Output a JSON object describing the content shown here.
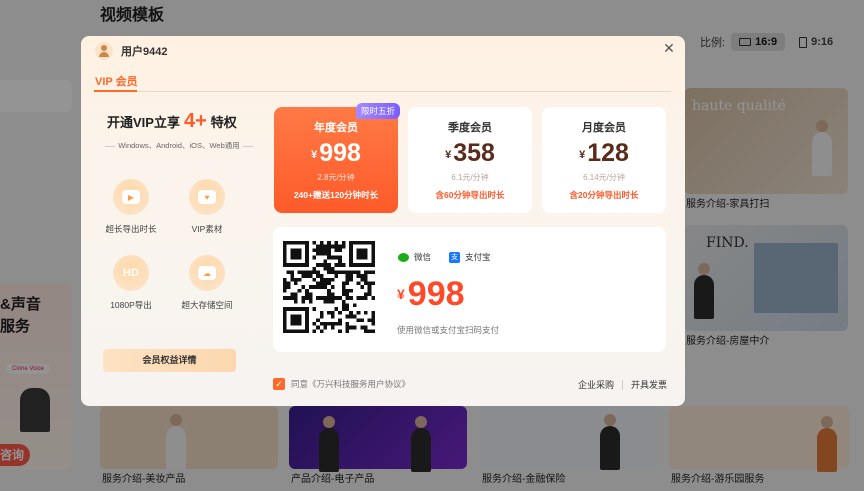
{
  "background": {
    "page_title": "视频模板",
    "ratio_label": "比例:",
    "ratios": [
      "16:9",
      "9:16"
    ],
    "promo": {
      "text_line1": "&声音",
      "text_line2": "服务",
      "tag": "Clone Voice",
      "button": "咨询"
    },
    "templates": [
      {
        "label": "服务介绍-家具打扫"
      },
      {
        "label": "服务介绍-房屋中介"
      },
      {
        "label": "服务介绍-美妆产品"
      },
      {
        "label": "产品介绍-电子产品"
      },
      {
        "label": "服务介绍-金融保险"
      },
      {
        "label": "服务介绍-游乐园服务"
      }
    ],
    "thumb_texts": {
      "haute": "haute qualité",
      "find": "FIND."
    }
  },
  "modal": {
    "user_name": "用户9442",
    "close_icon": "close-icon",
    "tab": "VIP 会员",
    "benefits": {
      "title_prefix": "开通VIP立享",
      "title_big": "4+",
      "title_suffix": "特权",
      "platforms": "Windows、Android、iOS、Web通用",
      "features": [
        {
          "icon": "video-icon",
          "label": "超长导出时长"
        },
        {
          "icon": "material-icon",
          "label": "VIP素材"
        },
        {
          "icon": "hd-icon",
          "label": "1080P导出",
          "glyph": "HD"
        },
        {
          "icon": "cloud-storage-icon",
          "label": "超大存储空间"
        }
      ],
      "details_button": "会员权益详情"
    },
    "plans": [
      {
        "name": "年度会员",
        "currency": "¥",
        "price": "998",
        "rate": "2.8元/分钟",
        "bonus": "240+赠送120分钟时长",
        "badge": "限时五折",
        "selected": true
      },
      {
        "name": "季度会员",
        "currency": "¥",
        "price": "358",
        "rate": "6.1元/分钟",
        "bonus": "含60分钟导出时长",
        "selected": false
      },
      {
        "name": "月度会员",
        "currency": "¥",
        "price": "128",
        "rate": "6.14元/分钟",
        "bonus": "含20分钟导出时长",
        "selected": false
      }
    ],
    "payment": {
      "methods": [
        "微信",
        "支付宝"
      ],
      "currency": "¥",
      "amount": "998",
      "hint": "使用微信或支付宝扫码支付"
    },
    "agreement": {
      "checked": true,
      "text": "同意《万兴科技服务用户协议》"
    },
    "footer_links": [
      "企业采购",
      "开具发票"
    ]
  },
  "colors": {
    "accent": "#ff5a2a",
    "badge": "#7b5cff",
    "wechat": "#1aad19",
    "alipay": "#1677ff"
  }
}
